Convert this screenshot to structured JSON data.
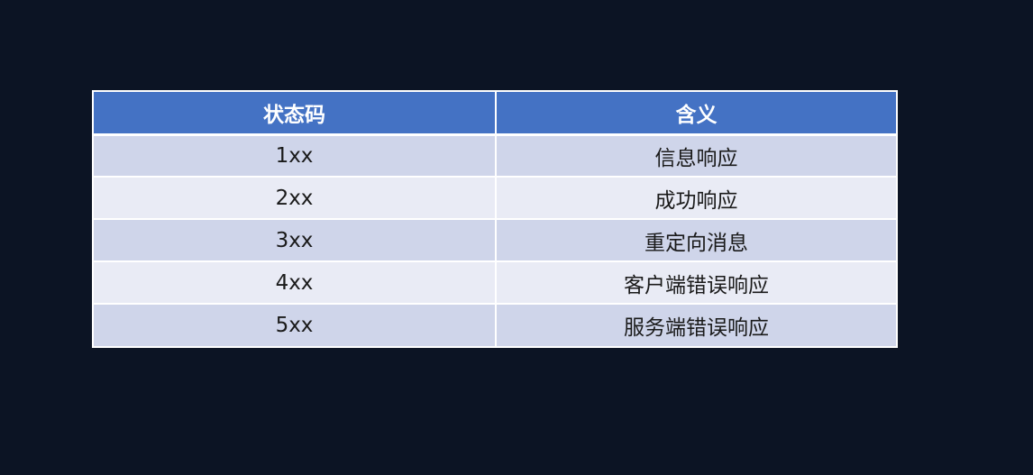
{
  "colors": {
    "background": "#0c1424",
    "header": "#4472c4",
    "row_band_dark": "#cfd5ea",
    "row_band_light": "#e9ebf5"
  },
  "table": {
    "headers": [
      "状态码",
      "含义"
    ],
    "rows": [
      [
        "1xx",
        "信息响应"
      ],
      [
        "2xx",
        "成功响应"
      ],
      [
        "3xx",
        "重定向消息"
      ],
      [
        "4xx",
        "客户端错误响应"
      ],
      [
        "5xx",
        "服务端错误响应"
      ]
    ]
  }
}
